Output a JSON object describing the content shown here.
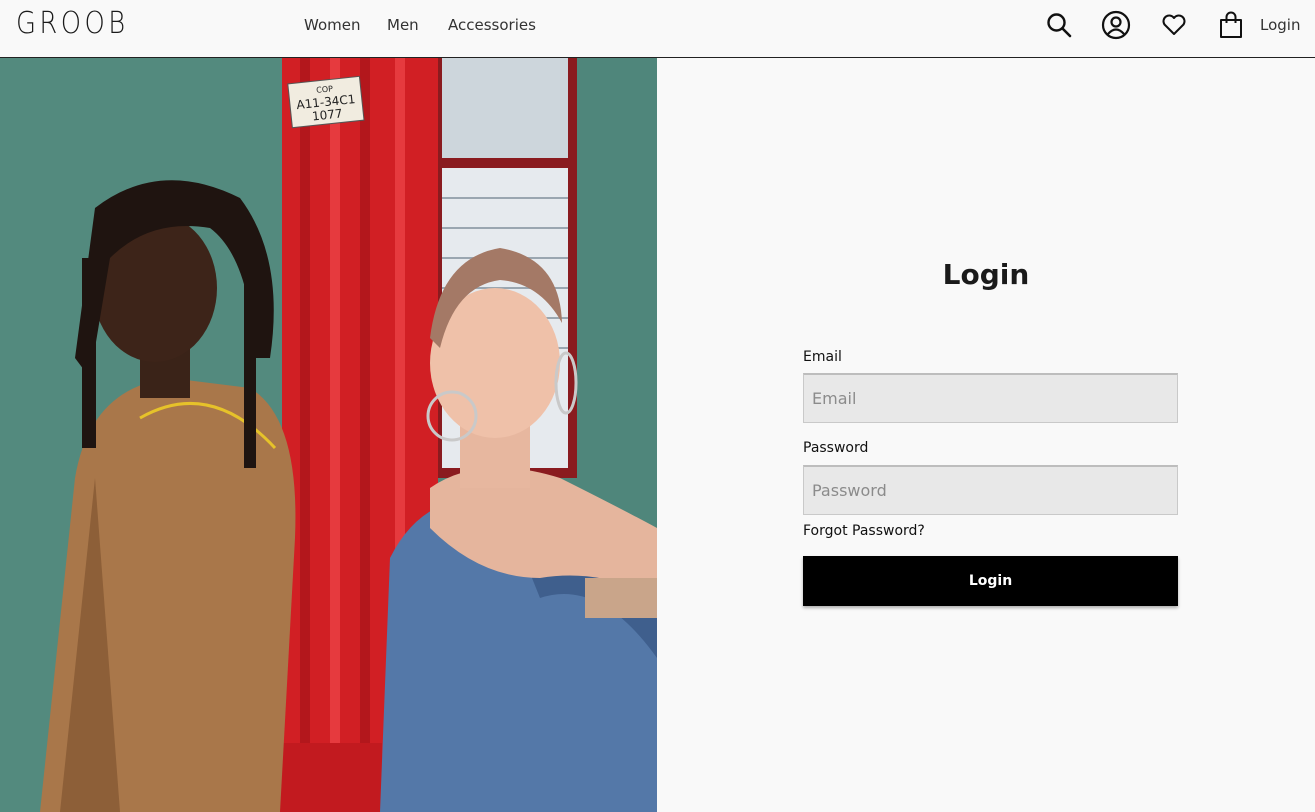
{
  "brand": {
    "logo": "GROOB"
  },
  "nav": {
    "women": "Women",
    "men": "Men",
    "accessories": "Accessories"
  },
  "header": {
    "login_link": "Login",
    "icons": [
      "search-icon",
      "account-icon",
      "heart-icon",
      "bag-icon"
    ]
  },
  "hero": {
    "sign_text_1": "COP",
    "sign_text_2": "A11-34C1",
    "sign_text_3": "1077"
  },
  "login_form": {
    "title": "Login",
    "email_label": "Email",
    "email_placeholder": "Email",
    "email_value": "",
    "password_label": "Password",
    "password_placeholder": "Password",
    "password_value": "",
    "forgot_link": "Forgot Password?",
    "submit_label": "Login"
  },
  "colors": {
    "accent": "#000000",
    "background": "#f9f9f9",
    "field_bg": "#e8e8e8"
  }
}
